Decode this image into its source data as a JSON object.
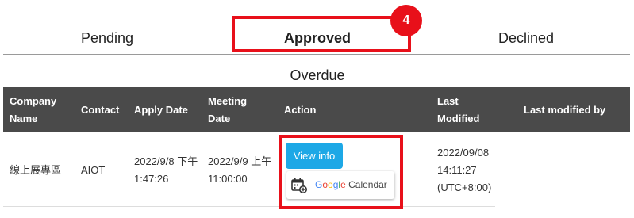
{
  "tabs": {
    "pending": "Pending",
    "approved": "Approved",
    "declined": "Declined",
    "overdue": "Overdue",
    "approved_badge": "4"
  },
  "table": {
    "headers": {
      "company": "Company Name",
      "contact": "Contact",
      "apply_date": "Apply Date",
      "meeting_date": "Meeting Date",
      "action": "Action",
      "last_modified": "Last Modified",
      "last_modified_by": "Last modified by"
    },
    "rows": [
      {
        "company": "線上展專區",
        "contact": "AIOT",
        "apply_date": "2022/9/8 下午1:47:26",
        "meeting_date": "2022/9/9 上午11:00:00",
        "view_label": "View info",
        "calendar_label": {
          "g1": "G",
          "g2": "o",
          "g3": "o",
          "g4": "g",
          "g5": "l",
          "g6": "e",
          "rest": " Calendar"
        },
        "last_modified": "2022/09/08 14:11:27 (UTC+8:00)",
        "last_modified_by": ""
      }
    ]
  },
  "colors": {
    "highlight": "#e8101a",
    "header_bg": "#4a4a4a",
    "view_button": "#1da8e6"
  },
  "icons": {
    "calendar": "calendar-add-icon"
  }
}
